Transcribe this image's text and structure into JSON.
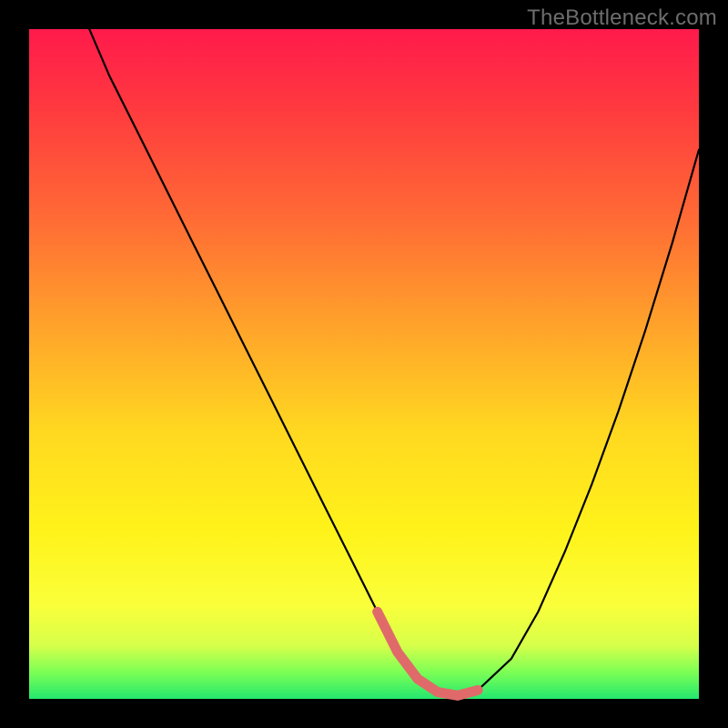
{
  "watermark": "TheBottleneck.com",
  "colors": {
    "frame": "#000000",
    "curve": "#000000",
    "highlight": "#e06a6a",
    "green_band": "#23e86e"
  },
  "chart_data": {
    "type": "line",
    "title": "",
    "xlabel": "",
    "ylabel": "",
    "xlim": [
      0,
      100
    ],
    "ylim": [
      0,
      100
    ],
    "series": [
      {
        "name": "bottleneck-curve",
        "x": [
          9,
          12,
          16,
          20,
          24,
          28,
          32,
          36,
          40,
          44,
          48,
          52,
          55,
          58,
          61,
          64,
          67,
          72,
          76,
          80,
          84,
          88,
          92,
          96,
          100
        ],
        "y": [
          100,
          93,
          85,
          77,
          69,
          61,
          53,
          45,
          37,
          29,
          21,
          13,
          7,
          3,
          1,
          0.5,
          1.3,
          6,
          13,
          22,
          32,
          43,
          55,
          68,
          82
        ]
      }
    ],
    "highlight_range_x": [
      52,
      69
    ],
    "annotations": []
  }
}
